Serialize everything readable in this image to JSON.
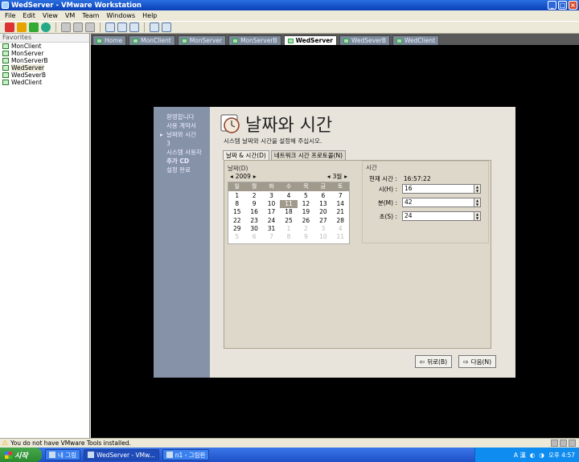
{
  "window": {
    "title": "WedServer - VMware Workstation"
  },
  "menu": [
    "File",
    "Edit",
    "View",
    "VM",
    "Team",
    "Windows",
    "Help"
  ],
  "sidebar": {
    "title": "Favorites",
    "items": [
      "MonClient",
      "MonServer",
      "MonServerB",
      "WedServer",
      "WedSeverB",
      "WedClient"
    ]
  },
  "tabs": [
    "Home",
    "MonClient",
    "MonServer",
    "MonServerB",
    "WedServer",
    "WedSeverB",
    "WedClient"
  ],
  "installer": {
    "steps": [
      "환영합니다",
      "사용 계약서",
      "날짜와 시간",
      "3",
      "시스템 사용자",
      "추가 CD",
      "설정 완료"
    ],
    "title": "날짜와 시간",
    "subtitle": "시스템 날짜와 시간을 설정해 주십시오.",
    "tabs": [
      "날짜 & 시간(D)",
      "네트워크 시간 프로토콜(N)"
    ],
    "date_label": "날짜(D)",
    "year": "2009",
    "month": "3월",
    "weekdays": [
      "일",
      "월",
      "화",
      "수",
      "목",
      "금",
      "토"
    ],
    "days": [
      [
        "1",
        "2",
        "3",
        "4",
        "5",
        "6",
        "7"
      ],
      [
        "8",
        "9",
        "10",
        "11",
        "12",
        "13",
        "14"
      ],
      [
        "15",
        "16",
        "17",
        "18",
        "19",
        "20",
        "21"
      ],
      [
        "22",
        "23",
        "24",
        "25",
        "26",
        "27",
        "28"
      ],
      [
        "29",
        "30",
        "31",
        "1",
        "2",
        "3",
        "4"
      ],
      [
        "5",
        "6",
        "7",
        "8",
        "9",
        "10",
        "11"
      ]
    ],
    "time_label": "시간",
    "current_time_label": "현재 시간 :",
    "current_time": "16:57:22",
    "hour_label": "시(H) :",
    "hour": "16",
    "minute_label": "분(M) :",
    "minute": "42",
    "second_label": "초(S) :",
    "second": "24",
    "back_label": "뒤로(B)",
    "next_label": "다음(N)"
  },
  "status": {
    "message": "You do not have VMware Tools installed."
  },
  "taskbar": {
    "start_label": "시작",
    "tasks": [
      "내 그림",
      "WedServer - VMw...",
      "n1 - 그림판"
    ],
    "tray_label": "A 漢",
    "clock": "오후 4:57"
  }
}
